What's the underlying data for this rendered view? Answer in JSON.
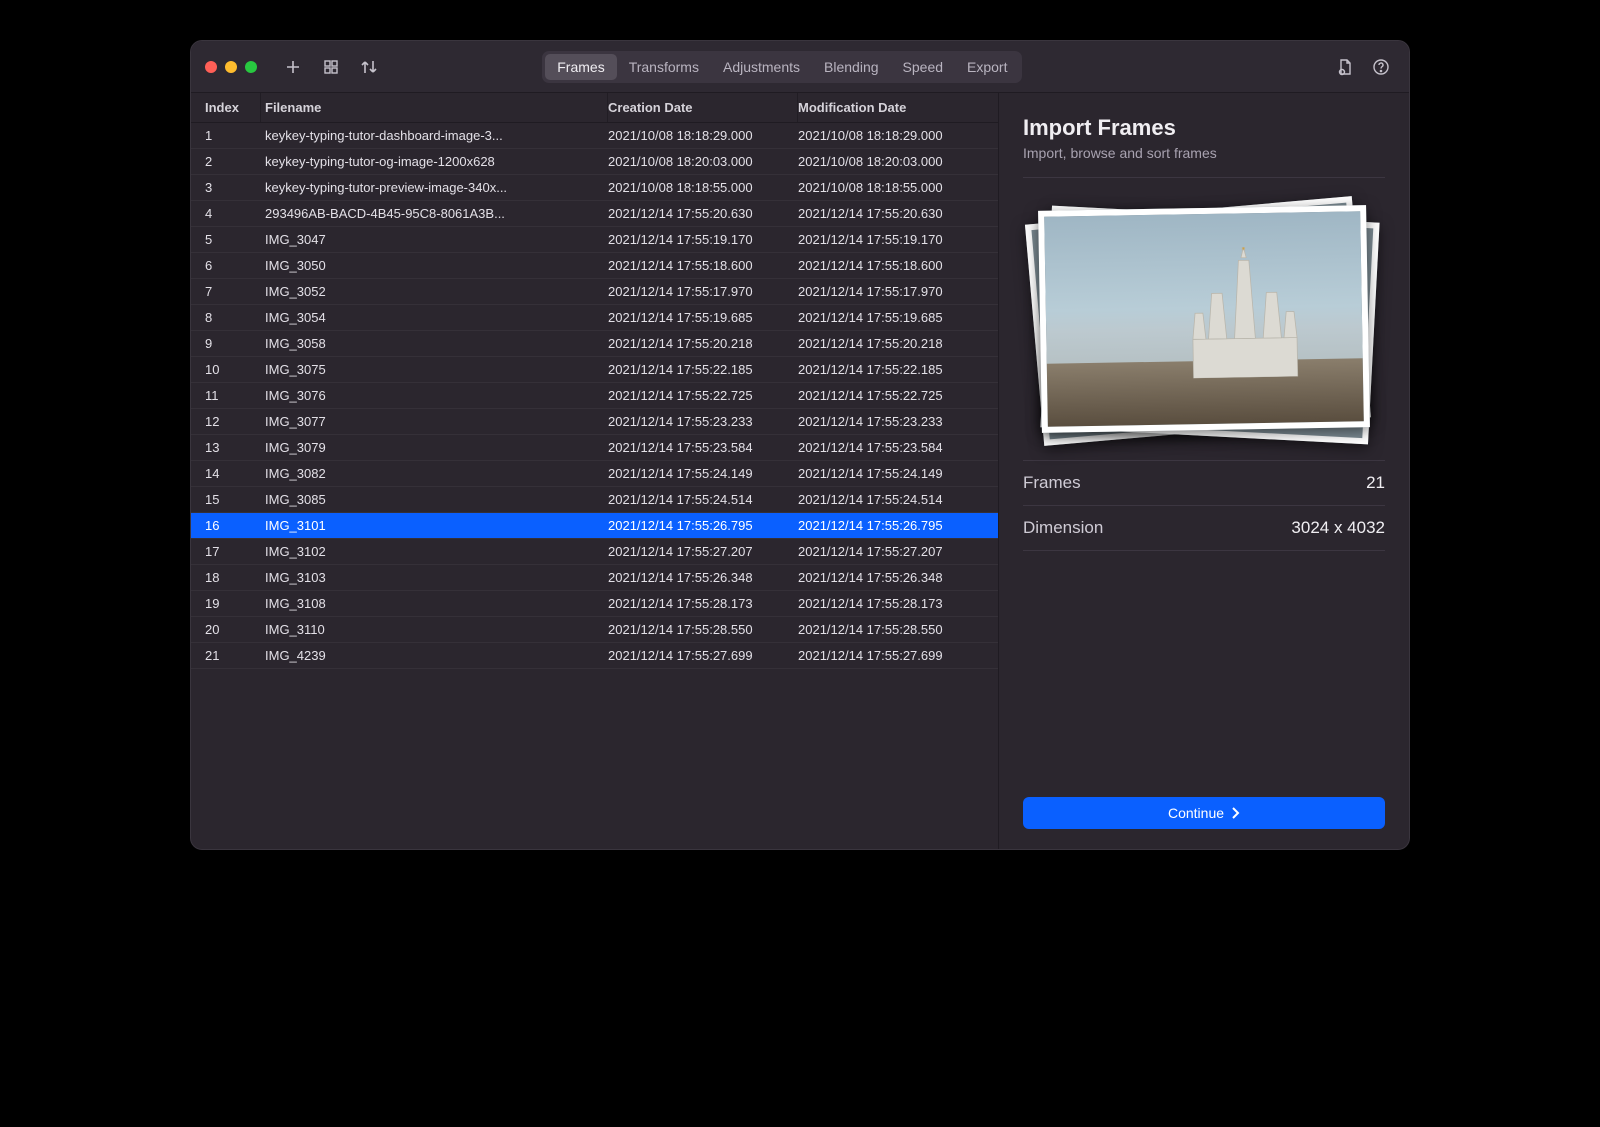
{
  "toolbar": {
    "tabs": [
      "Frames",
      "Transforms",
      "Adjustments",
      "Blending",
      "Speed",
      "Export"
    ],
    "active_tab_index": 0
  },
  "table": {
    "headers": {
      "index": "Index",
      "filename": "Filename",
      "cdate": "Creation Date",
      "mdate": "Modification Date"
    },
    "selected_index": 15,
    "rows": [
      {
        "index": "1",
        "filename": "keykey-typing-tutor-dashboard-image-3...",
        "cdate": "2021/10/08 18:18:29.000",
        "mdate": "2021/10/08 18:18:29.000"
      },
      {
        "index": "2",
        "filename": "keykey-typing-tutor-og-image-1200x628",
        "cdate": "2021/10/08 18:20:03.000",
        "mdate": "2021/10/08 18:20:03.000"
      },
      {
        "index": "3",
        "filename": "keykey-typing-tutor-preview-image-340x...",
        "cdate": "2021/10/08 18:18:55.000",
        "mdate": "2021/10/08 18:18:55.000"
      },
      {
        "index": "4",
        "filename": "293496AB-BACD-4B45-95C8-8061A3B...",
        "cdate": "2021/12/14 17:55:20.630",
        "mdate": "2021/12/14 17:55:20.630"
      },
      {
        "index": "5",
        "filename": "IMG_3047",
        "cdate": "2021/12/14 17:55:19.170",
        "mdate": "2021/12/14 17:55:19.170"
      },
      {
        "index": "6",
        "filename": "IMG_3050",
        "cdate": "2021/12/14 17:55:18.600",
        "mdate": "2021/12/14 17:55:18.600"
      },
      {
        "index": "7",
        "filename": "IMG_3052",
        "cdate": "2021/12/14 17:55:17.970",
        "mdate": "2021/12/14 17:55:17.970"
      },
      {
        "index": "8",
        "filename": "IMG_3054",
        "cdate": "2021/12/14 17:55:19.685",
        "mdate": "2021/12/14 17:55:19.685"
      },
      {
        "index": "9",
        "filename": "IMG_3058",
        "cdate": "2021/12/14 17:55:20.218",
        "mdate": "2021/12/14 17:55:20.218"
      },
      {
        "index": "10",
        "filename": "IMG_3075",
        "cdate": "2021/12/14 17:55:22.185",
        "mdate": "2021/12/14 17:55:22.185"
      },
      {
        "index": "11",
        "filename": "IMG_3076",
        "cdate": "2021/12/14 17:55:22.725",
        "mdate": "2021/12/14 17:55:22.725"
      },
      {
        "index": "12",
        "filename": "IMG_3077",
        "cdate": "2021/12/14 17:55:23.233",
        "mdate": "2021/12/14 17:55:23.233"
      },
      {
        "index": "13",
        "filename": "IMG_3079",
        "cdate": "2021/12/14 17:55:23.584",
        "mdate": "2021/12/14 17:55:23.584"
      },
      {
        "index": "14",
        "filename": "IMG_3082",
        "cdate": "2021/12/14 17:55:24.149",
        "mdate": "2021/12/14 17:55:24.149"
      },
      {
        "index": "15",
        "filename": "IMG_3085",
        "cdate": "2021/12/14 17:55:24.514",
        "mdate": "2021/12/14 17:55:24.514"
      },
      {
        "index": "16",
        "filename": "IMG_3101",
        "cdate": "2021/12/14 17:55:26.795",
        "mdate": "2021/12/14 17:55:26.795"
      },
      {
        "index": "17",
        "filename": "IMG_3102",
        "cdate": "2021/12/14 17:55:27.207",
        "mdate": "2021/12/14 17:55:27.207"
      },
      {
        "index": "18",
        "filename": "IMG_3103",
        "cdate": "2021/12/14 17:55:26.348",
        "mdate": "2021/12/14 17:55:26.348"
      },
      {
        "index": "19",
        "filename": "IMG_3108",
        "cdate": "2021/12/14 17:55:28.173",
        "mdate": "2021/12/14 17:55:28.173"
      },
      {
        "index": "20",
        "filename": "IMG_3110",
        "cdate": "2021/12/14 17:55:28.550",
        "mdate": "2021/12/14 17:55:28.550"
      },
      {
        "index": "21",
        "filename": "IMG_4239",
        "cdate": "2021/12/14 17:55:27.699",
        "mdate": "2021/12/14 17:55:27.699"
      }
    ]
  },
  "panel": {
    "title": "Import Frames",
    "subtitle": "Import, browse and sort frames",
    "frames_label": "Frames",
    "frames_value": "21",
    "dimension_label": "Dimension",
    "dimension_value": "3024 x 4032",
    "continue_label": "Continue"
  }
}
